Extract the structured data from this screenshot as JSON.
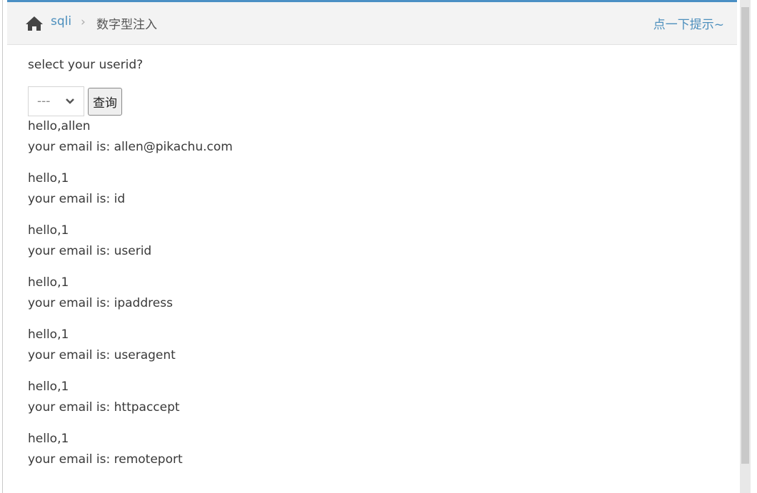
{
  "breadcrumb": {
    "section": "sqli",
    "current": "数字型注入",
    "hint": "点一下提示~"
  },
  "form": {
    "prompt": "select your userid?",
    "select_value": "---",
    "submit_label": "查询"
  },
  "results": [
    {
      "hello": "hello,allen",
      "email": "your email is: allen@pikachu.com"
    },
    {
      "hello": "hello,1",
      "email": "your email is: id"
    },
    {
      "hello": "hello,1",
      "email": "your email is: userid"
    },
    {
      "hello": "hello,1",
      "email": "your email is: ipaddress"
    },
    {
      "hello": "hello,1",
      "email": "your email is: useragent"
    },
    {
      "hello": "hello,1",
      "email": "your email is: httpaccept"
    },
    {
      "hello": "hello,1",
      "email": "your email is: remoteport"
    }
  ]
}
